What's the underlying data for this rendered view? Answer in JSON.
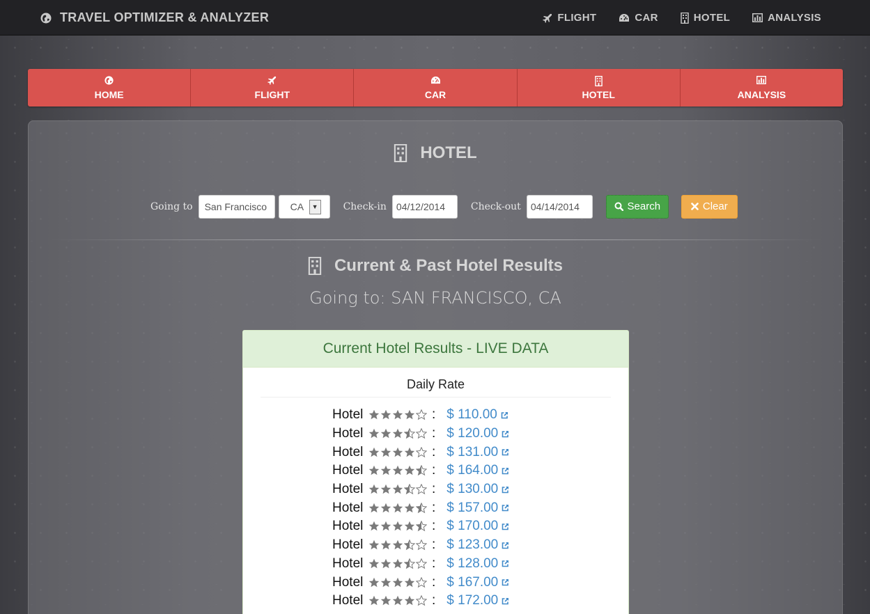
{
  "navbar": {
    "brand": "TRAVEL OPTIMIZER & ANALYZER",
    "brand_icon": "globe-icon",
    "items": [
      {
        "label": "FLIGHT",
        "icon": "plane-icon"
      },
      {
        "label": "CAR",
        "icon": "dashboard-icon"
      },
      {
        "label": "HOTEL",
        "icon": "building-icon"
      },
      {
        "label": "ANALYSIS",
        "icon": "bar-chart-icon"
      }
    ]
  },
  "tabs": [
    {
      "label": "HOME",
      "icon": "globe-icon"
    },
    {
      "label": "FLIGHT",
      "icon": "plane-icon"
    },
    {
      "label": "CAR",
      "icon": "dashboard-icon"
    },
    {
      "label": "HOTEL",
      "icon": "building-icon"
    },
    {
      "label": "ANALYSIS",
      "icon": "bar-chart-icon"
    }
  ],
  "panel": {
    "title": "HOTEL"
  },
  "form": {
    "going_to_label": "Going to",
    "going_to_value": "San Francisco",
    "state_value": "CA",
    "checkin_label": "Check-in",
    "checkin_value": "04/12/2014",
    "checkout_label": "Check-out",
    "checkout_value": "04/14/2014",
    "search_label": "Search",
    "clear_label": "Clear"
  },
  "results": {
    "title": "Current & Past Hotel Results",
    "going_to": "Going to: SAN FRANCISCO, CA",
    "card_title": "Current Hotel Results - ",
    "card_title_live": "LIVE DATA",
    "column_header": "Daily Rate",
    "rows": [
      {
        "label": "Hotel",
        "stars": 4,
        "price": "$ 110.00"
      },
      {
        "label": "Hotel",
        "stars": 3.5,
        "price": "$ 120.00"
      },
      {
        "label": "Hotel",
        "stars": 4,
        "price": "$ 131.00"
      },
      {
        "label": "Hotel",
        "stars": 4.5,
        "price": "$ 164.00"
      },
      {
        "label": "Hotel",
        "stars": 3.5,
        "price": "$ 130.00"
      },
      {
        "label": "Hotel",
        "stars": 4.5,
        "price": "$ 157.00"
      },
      {
        "label": "Hotel",
        "stars": 4.5,
        "price": "$ 170.00"
      },
      {
        "label": "Hotel",
        "stars": 3.5,
        "price": "$ 123.00"
      },
      {
        "label": "Hotel",
        "stars": 3.5,
        "price": "$ 128.00"
      },
      {
        "label": "Hotel",
        "stars": 4,
        "price": "$ 167.00"
      },
      {
        "label": "Hotel",
        "stars": 4,
        "price": "$ 172.00"
      }
    ]
  },
  "colors": {
    "tab_red": "#d9534f",
    "search_green": "#47a447",
    "clear_orange": "#f0ad4e",
    "link_blue": "#428bca",
    "card_green_bg": "#dff0d8",
    "card_green_text": "#3c763d"
  }
}
